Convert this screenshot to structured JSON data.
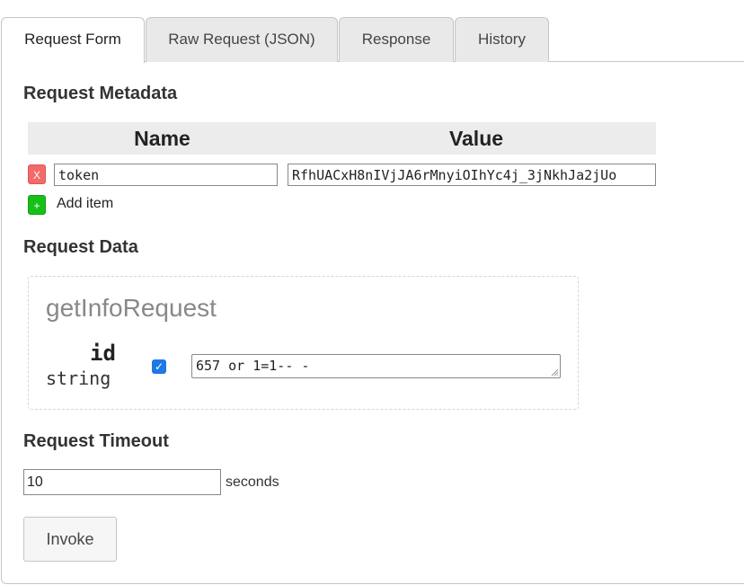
{
  "tabs": [
    {
      "label": "Request Form",
      "active": true
    },
    {
      "label": "Raw Request (JSON)",
      "active": false
    },
    {
      "label": "Response",
      "active": false
    },
    {
      "label": "History",
      "active": false
    }
  ],
  "metadata": {
    "heading": "Request Metadata",
    "columns": [
      "Name",
      "Value"
    ],
    "rows": [
      {
        "name": "token",
        "value": "RfhUACxH8nIVjJA6rMnyiOIhYc4j_3jNkhJa2jUo"
      }
    ],
    "remove_label": "X",
    "add_icon": "+",
    "add_label": "Add item"
  },
  "request_data": {
    "heading": "Request Data",
    "message_name": "getInfoRequest",
    "fields": [
      {
        "name": "id",
        "type": "string",
        "checked": true,
        "value": "657 or 1=1-- -"
      }
    ]
  },
  "timeout": {
    "heading": "Request Timeout",
    "value": "10",
    "unit": "seconds"
  },
  "invoke_label": "Invoke",
  "colors": {
    "remove": "#f26a6a",
    "add": "#17c017",
    "checkbox": "#1e78e6"
  }
}
